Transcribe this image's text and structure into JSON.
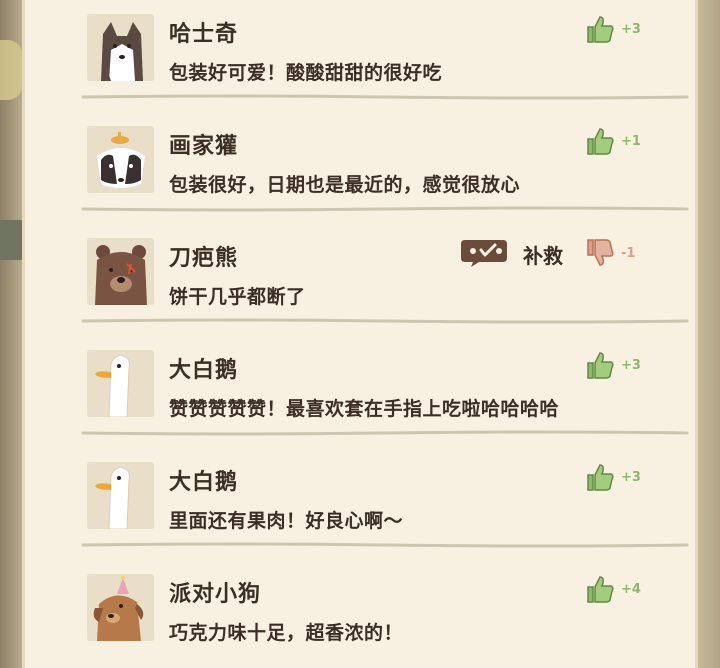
{
  "colors": {
    "panel_bg": "#f8f1e2",
    "text": "#3b2e24",
    "like_green": "#8eb86a",
    "dislike_salmon": "#d9a189",
    "remedy_brown": "#6b4c3b"
  },
  "reviews": [
    {
      "name": "哈士奇",
      "comment": "包装好可爱！酸酸甜甜的很好吃",
      "reaction": "thumbs-up",
      "count": "+3",
      "avatar": "husky"
    },
    {
      "name": "画家獾",
      "comment": "包装很好，日期也是最近的，感觉很放心",
      "reaction": "thumbs-up",
      "count": "+1",
      "avatar": "badger"
    },
    {
      "name": "刀疤熊",
      "comment": "饼干几乎都断了",
      "reaction": "thumbs-down",
      "count": "-1",
      "avatar": "bear",
      "remedy_label": "补救"
    },
    {
      "name": "大白鹅",
      "comment": "赞赞赞赞赞！最喜欢套在手指上吃啦哈哈哈哈",
      "reaction": "thumbs-up",
      "count": "+3",
      "avatar": "goose"
    },
    {
      "name": "大白鹅",
      "comment": "里面还有果肉！好良心啊～",
      "reaction": "thumbs-up",
      "count": "+3",
      "avatar": "goose"
    },
    {
      "name": "派对小狗",
      "comment": "巧克力味十足，超香浓的！",
      "reaction": "thumbs-up",
      "count": "+4",
      "avatar": "dog"
    }
  ]
}
